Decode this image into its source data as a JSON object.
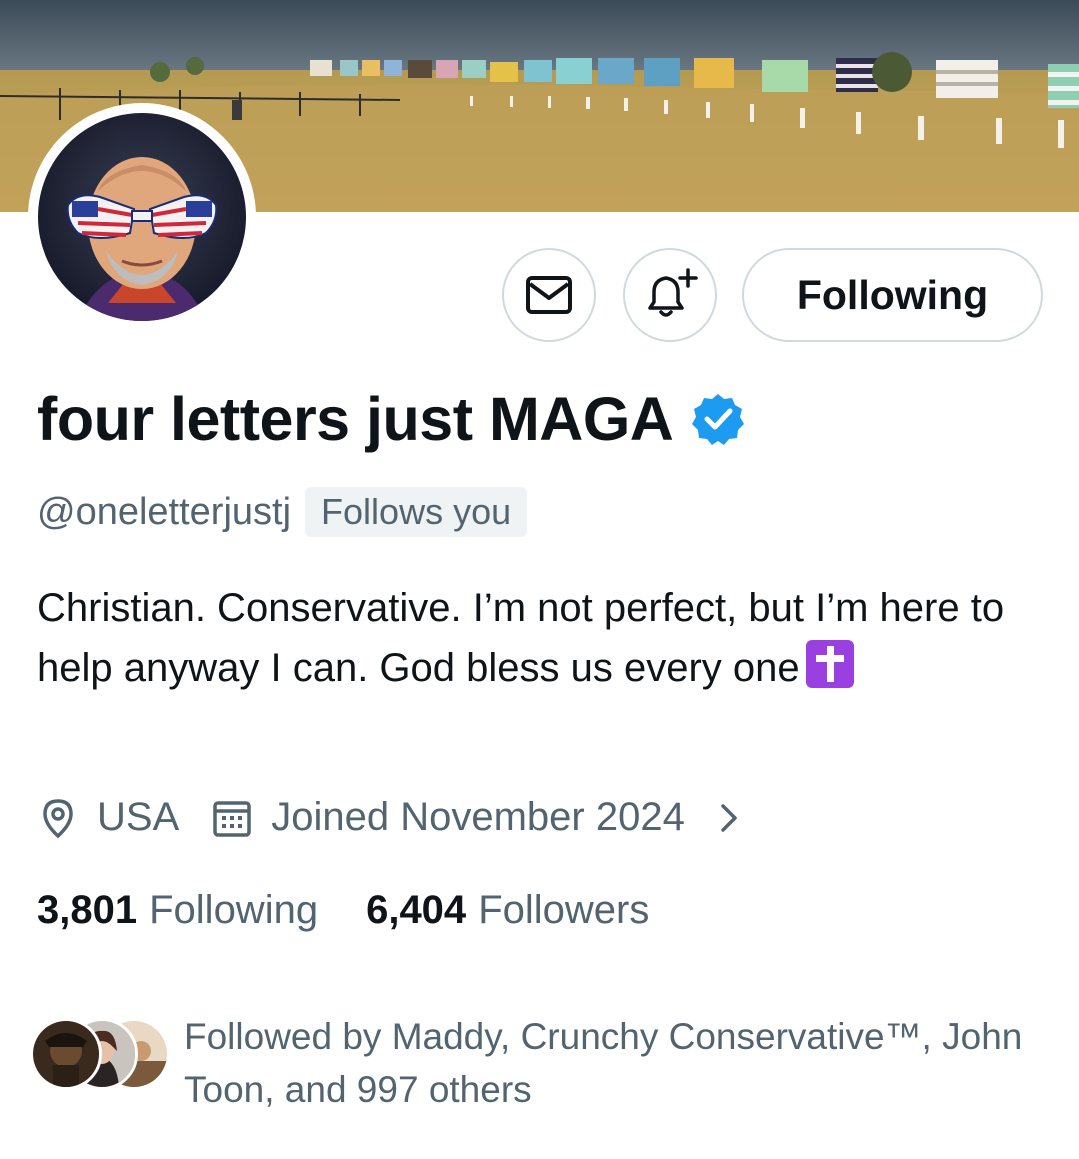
{
  "banner": {
    "description_icon": "beach-huts-banner"
  },
  "actions": {
    "message_icon": "mail-icon",
    "notify_icon": "bell-plus-icon",
    "following_label": "Following"
  },
  "profile": {
    "display_name": "four letters just MAGA",
    "verified_icon": "verified-badge-icon",
    "verified_color": "#1d9bf0",
    "handle": "@oneletterjustj",
    "follows_you": "Follows you",
    "bio": "Christian. Conservative. I’m not perfect, but I’m here to help anyway I can. God bless us every one",
    "bio_emoji": "latin-cross-emoji",
    "location": "USA",
    "joined": "Joined November 2024"
  },
  "stats": {
    "following_count": "3,801",
    "following_label": "Following",
    "followers_count": "6,404",
    "followers_label": "Followers"
  },
  "followed_by": {
    "text": "Followed by Maddy, Crunchy Conservative™, John Toon, and 997 others"
  },
  "colors": {
    "text_primary": "#0f1419",
    "text_secondary": "#536471",
    "border": "#cfd9de",
    "pill_bg": "#eff3f4"
  }
}
